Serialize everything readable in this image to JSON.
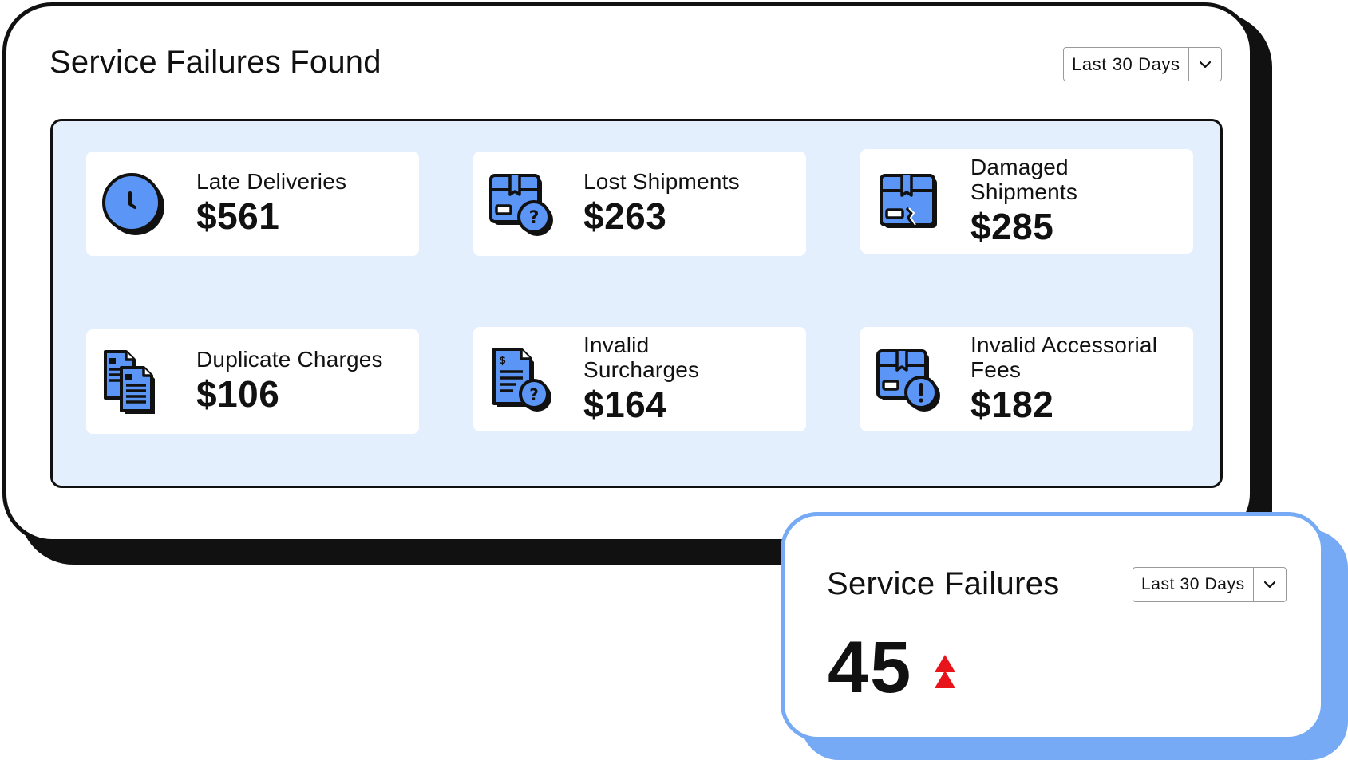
{
  "service_failures_found": {
    "title": "Service Failures Found",
    "range_select": {
      "value": "Last 30 Days"
    },
    "cards": [
      {
        "label": "Late Deliveries",
        "value": "$561",
        "icon": "clock-icon"
      },
      {
        "label": "Lost Shipments",
        "value": "$263",
        "icon": "box-question-icon"
      },
      {
        "label": "Damaged Shipments",
        "value": "$285",
        "icon": "damaged-box-icon"
      },
      {
        "label": "Duplicate Charges",
        "value": "$106",
        "icon": "duplicate-documents-icon"
      },
      {
        "label": "Invalid Surcharges",
        "value": "$164",
        "icon": "invoice-question-icon"
      },
      {
        "label": "Invalid Accessorial Fees",
        "value": "$182",
        "icon": "box-alert-icon"
      }
    ]
  },
  "service_failures": {
    "title": "Service Failures",
    "range_select": {
      "value": "Last 30 Days"
    },
    "value": "45",
    "trend": "up"
  },
  "colors": {
    "accent_blue": "#5b95f5",
    "panel_tint": "#e3effd",
    "secondary_border": "#77aaf5",
    "trend_red": "#e8141b",
    "ink": "#111111"
  }
}
